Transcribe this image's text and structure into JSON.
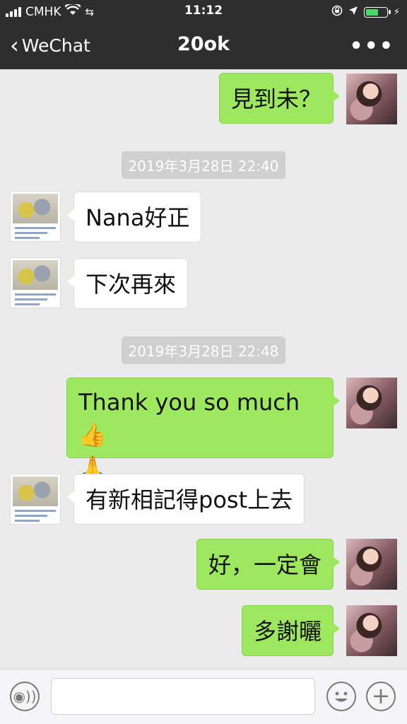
{
  "status_bar": {
    "carrier": "CMHK",
    "time": "11:12"
  },
  "nav": {
    "back_label": "WeChat",
    "title": "20ok"
  },
  "messages": [
    {
      "side": "me",
      "text": "見到未？"
    },
    {
      "type": "timestamp",
      "text": "2019年3月28日 22:40"
    },
    {
      "side": "other",
      "text": "Nana好正"
    },
    {
      "side": "other",
      "text": "下次再來"
    },
    {
      "type": "timestamp",
      "text": "2019年3月28日 22:48"
    },
    {
      "side": "me",
      "text": "Thank you so much",
      "emojis": [
        "👍",
        "🙏"
      ]
    },
    {
      "side": "other",
      "text": "有新相記得post上去"
    },
    {
      "side": "me",
      "text": "好，一定會"
    },
    {
      "side": "me",
      "text": "多謝曬"
    }
  ],
  "input": {
    "placeholder": ""
  },
  "colors": {
    "topbar": "#2e2e2e",
    "chat_bg": "#ebebeb",
    "my_bubble": "#9ee85f",
    "other_bubble": "#ffffff",
    "battery": "#4cd964"
  },
  "icons": [
    "back-chevron-icon",
    "more-icon",
    "voice-icon",
    "emoji-icon",
    "plus-icon",
    "wifi-icon",
    "signal-icon",
    "battery-icon",
    "location-icon",
    "lock-rotation-icon",
    "hotspot-icon"
  ]
}
